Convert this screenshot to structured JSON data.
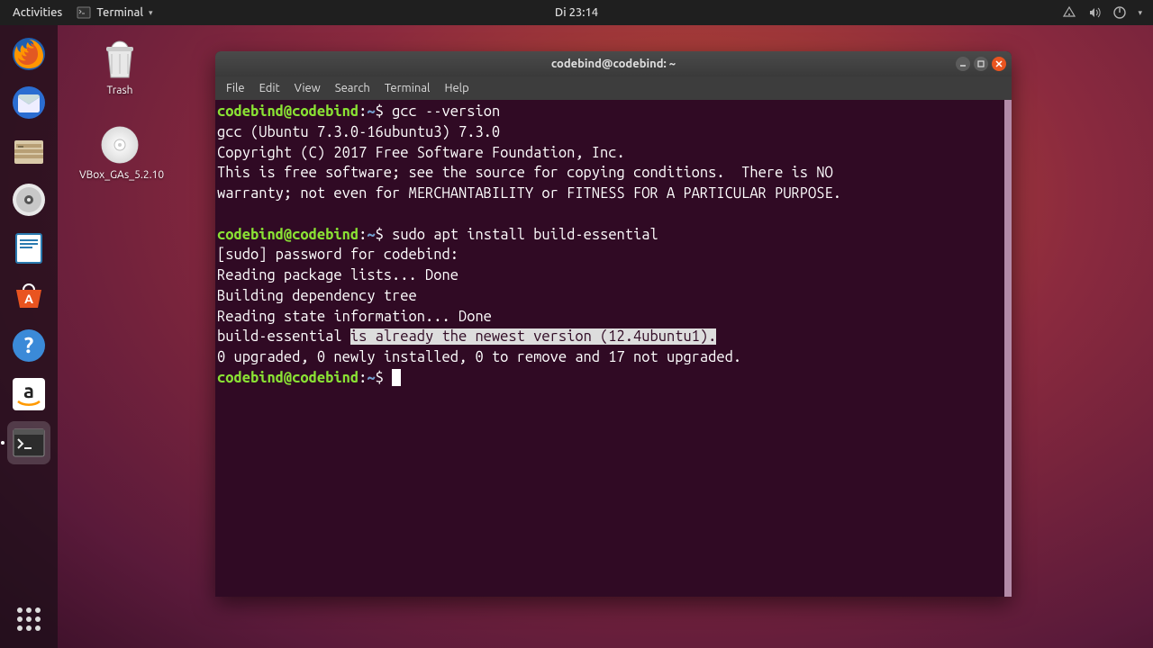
{
  "panel": {
    "activities": "Activities",
    "app_name": "Terminal",
    "clock": "Di 23:14"
  },
  "desktop": {
    "trash_label": "Trash",
    "vbox_label": "VBox_GAs_5.2.10"
  },
  "terminal": {
    "title": "codebind@codebind: ~",
    "menu": {
      "file": "File",
      "edit": "Edit",
      "view": "View",
      "search": "Search",
      "terminal": "Terminal",
      "help": "Help"
    },
    "prompt_user": "codebind@codebind",
    "prompt_path": "~",
    "lines": {
      "cmd1": "gcc --version",
      "out1": "gcc (Ubuntu 7.3.0-16ubuntu3) 7.3.0",
      "out2": "Copyright (C) 2017 Free Software Foundation, Inc.",
      "out3": "This is free software; see the source for copying conditions.  There is NO",
      "out4": "warranty; not even for MERCHANTABILITY or FITNESS FOR A PARTICULAR PURPOSE.",
      "cmd2": "sudo apt install build-essential",
      "out5": "[sudo] password for codebind: ",
      "out6": "Reading package lists... Done",
      "out7": "Building dependency tree       ",
      "out8": "Reading state information... Done",
      "out9_pre": "build-essential ",
      "out9_sel": "is already the newest version (12.4ubuntu1).",
      "out10": "0 upgraded, 0 newly installed, 0 to remove and 17 not upgraded."
    }
  }
}
